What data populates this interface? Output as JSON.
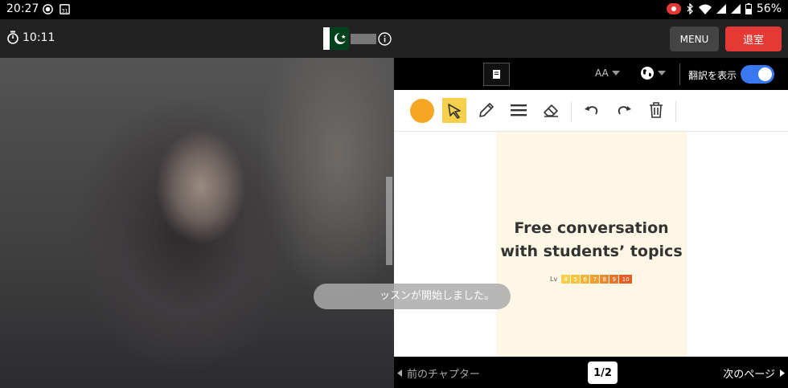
{
  "status_bar": {
    "time": "20:27",
    "battery": "56%",
    "icons": [
      "record-icon",
      "calendar-icon",
      "screen-record-icon",
      "bluetooth-icon",
      "wifi-icon",
      "signal-icon",
      "signal-icon",
      "battery-icon"
    ]
  },
  "video": {
    "timer": "10:11",
    "toast": "ッスンが開始しました。"
  },
  "header": {
    "menu_label": "MENU",
    "exit_label": "退室"
  },
  "toolbar": {
    "font_label": "AA",
    "translate_label": "翻訳を表示",
    "translate_on": true
  },
  "tools": [
    "color-picker",
    "select-tool",
    "pen-tool",
    "line-width-tool",
    "eraser-tool",
    "undo",
    "redo",
    "trash"
  ],
  "slide": {
    "title_line1": "Free conversation",
    "title_line2": "with students’ topics",
    "level_label": "Lv",
    "levels": [
      "4",
      "5",
      "6",
      "7",
      "8",
      "9",
      "10"
    ],
    "level_colors": [
      "#f6d04d",
      "#f4c542",
      "#f2b53a",
      "#ee9f34",
      "#ea8a30",
      "#e6752c",
      "#e25f28"
    ]
  },
  "footer": {
    "prev_label": "前のチャプター",
    "page_label": "1/2",
    "next_label": "次のページ"
  },
  "colors": {
    "accent_red": "#e53935",
    "toggle_blue": "#3a78f2",
    "highlight_yellow": "#f6d04d",
    "pen_orange": "#f5a623"
  }
}
